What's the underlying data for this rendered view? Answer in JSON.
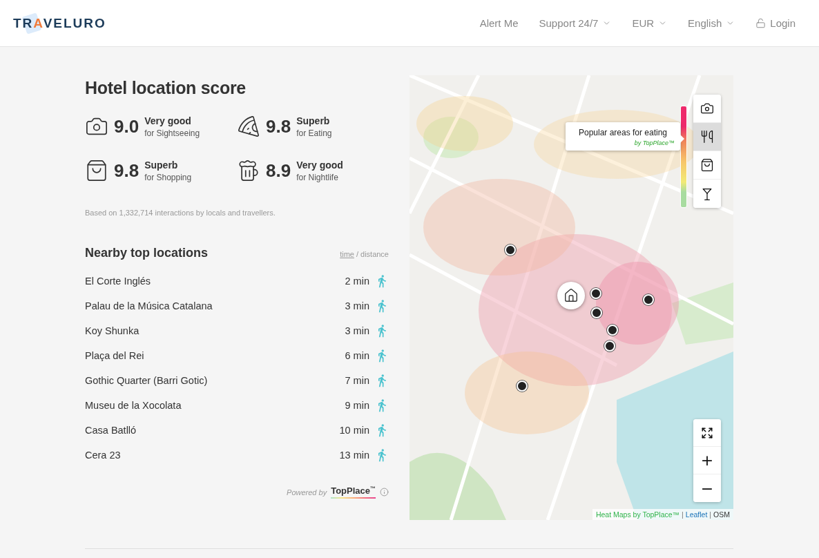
{
  "header": {
    "logo": {
      "before": "TR",
      "accent": "A",
      "after": "VELURO"
    },
    "nav": [
      {
        "kind": "link",
        "label": "Alert Me"
      },
      {
        "kind": "dropdown",
        "label": "Support 24/7"
      },
      {
        "kind": "dropdown",
        "label": "EUR"
      },
      {
        "kind": "dropdown",
        "label": "English"
      },
      {
        "kind": "login",
        "label": "Login"
      }
    ]
  },
  "score": {
    "title": "Hotel location score",
    "items": [
      {
        "kind": "sightseeing",
        "value": "9.0",
        "rating": "Very good",
        "category": "for Sightseeing"
      },
      {
        "kind": "eating",
        "value": "9.8",
        "rating": "Superb",
        "category": "for Eating"
      },
      {
        "kind": "shopping",
        "value": "9.8",
        "rating": "Superb",
        "category": "for Shopping"
      },
      {
        "kind": "nightlife",
        "value": "8.9",
        "rating": "Very good",
        "category": "for Nightlife"
      }
    ],
    "note": "Based on 1,332,714 interactions by locals and travellers."
  },
  "nearby": {
    "title": "Nearby top locations",
    "toggle": [
      {
        "label": "time",
        "selected": true
      },
      {
        "label": "distance",
        "selected": false
      }
    ],
    "separator": "/",
    "rows": [
      {
        "name": "El Corte Inglés",
        "time": "2 min"
      },
      {
        "name": "Palau de la Música Catalana",
        "time": "3 min"
      },
      {
        "name": "Koy Shunka",
        "time": "3 min"
      },
      {
        "name": "Plaça del Rei",
        "time": "6 min"
      },
      {
        "name": "Gothic Quarter (Barri Gotic)",
        "time": "7 min"
      },
      {
        "name": "Museu de la Xocolata",
        "time": "9 min"
      },
      {
        "name": "Casa Batlló",
        "time": "10 min"
      },
      {
        "name": "Cera 23",
        "time": "13 min"
      }
    ],
    "powered_by": {
      "prefix": "Powered by",
      "brand": "TopPlace",
      "mark": "™"
    }
  },
  "map": {
    "layers": [
      {
        "kind": "sightseeing",
        "selected": false
      },
      {
        "kind": "eating",
        "selected": true
      },
      {
        "kind": "shopping",
        "selected": false
      },
      {
        "kind": "nightlife",
        "selected": false
      }
    ],
    "tooltip": {
      "title": "Popular areas for eating",
      "source": "by TopPlace™"
    },
    "zoom": [
      {
        "kind": "fullscreen"
      },
      {
        "kind": "in",
        "label": "+"
      },
      {
        "kind": "out",
        "label": "−"
      }
    ],
    "attribution": [
      {
        "kind": "credit",
        "text": "Heat Maps by TopPlace™"
      },
      {
        "kind": "sep",
        "text": "|"
      },
      {
        "kind": "link",
        "text": "Leaflet"
      },
      {
        "kind": "sep",
        "text": "|"
      },
      {
        "kind": "text",
        "text": "OSM"
      }
    ]
  }
}
